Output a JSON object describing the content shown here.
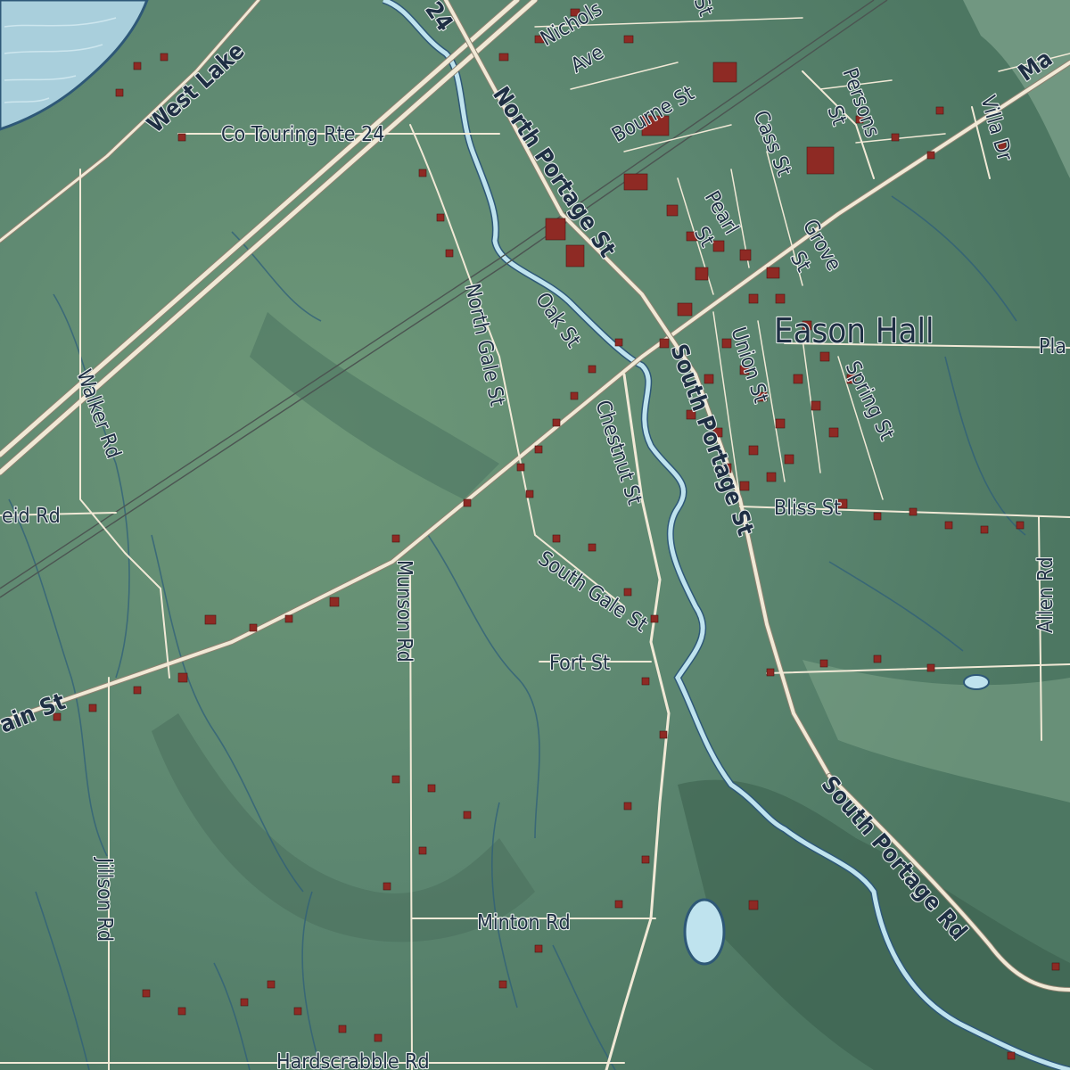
{
  "map": {
    "place_label": "Eason Hall",
    "road_labels": {
      "west_lake": "West Lake",
      "touring_rte": "Co Touring Rte 24",
      "route_24_fragment": "24",
      "nichols_ave_a": "Nichols",
      "nichols_ave_b": "Ave",
      "bourne_st": "Bourne St",
      "north_portage_st": "North Portage St",
      "south_portage_st": "South Portage St",
      "south_portage_rd": "South Portage Rd",
      "cass_st": "Cass St",
      "persons_st_a": "Persons",
      "persons_st_b": "St",
      "pearl_st_a": "Pearl",
      "pearl_st_b": "St",
      "grove_st_a": "Grove",
      "grove_st_b": "St",
      "union_st": "Union St",
      "spring_st": "Spring St",
      "villa_dr": "Villa Dr",
      "oak_st": "Oak St",
      "north_gale_st": "North Gale St",
      "chestnut_st": "Chestnut St",
      "south_gale_st": "South Gale St",
      "bliss_st": "Bliss St",
      "fort_st": "Fort St",
      "allen_rd": "Allen Rd",
      "walker_rd": "Walker Rd",
      "reid_rd": "eid Rd",
      "munson_rd": "Munson Rd",
      "main_st": "ain St",
      "main_st_ne": "Ma",
      "jillson_rd": "Jillson Rd",
      "minton_rd": "Minton Rd",
      "hardscrabble_rd": "Hardscrabble Rd",
      "pla_fragment": "Pla",
      "st_fragment": "St"
    },
    "colors": {
      "land": "#5f8a70",
      "water": "#bfe3ee",
      "building": "#8e2a24",
      "road": "#f1e9d6",
      "label": "#1f2f44"
    }
  }
}
